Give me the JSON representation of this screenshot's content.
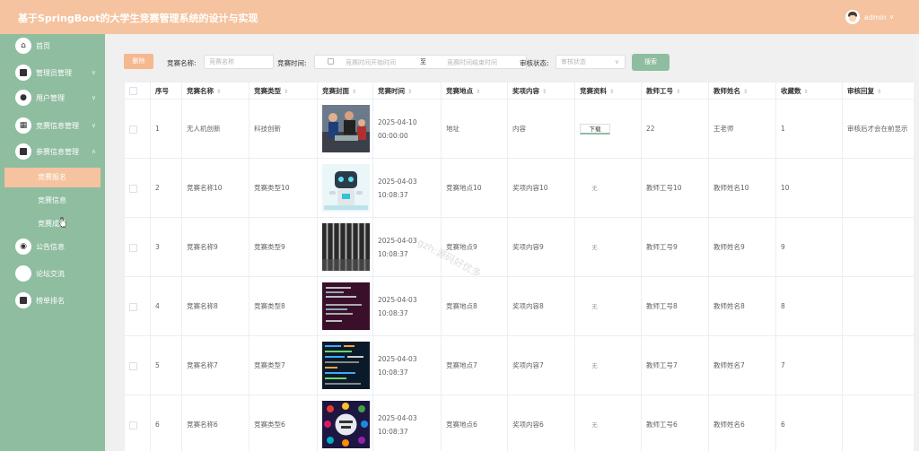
{
  "header": {
    "title": "基于SpringBoot的大学生竞赛管理系统的设计与实现",
    "username": "admin"
  },
  "sidebar": {
    "items": [
      {
        "label": "首页",
        "icon": "home-icon"
      },
      {
        "label": "管理员管理",
        "icon": "admin-icon"
      },
      {
        "label": "用户管理",
        "icon": "user-icon"
      },
      {
        "label": "竞赛信息管理",
        "icon": "grid-icon"
      },
      {
        "label": "参赛信息管理",
        "icon": "copy-icon"
      },
      {
        "label": "公告信息",
        "icon": "notice-icon"
      },
      {
        "label": "论坛交流",
        "icon": "forum-icon"
      },
      {
        "label": "榜单排名",
        "icon": "ranking-icon"
      }
    ],
    "subitems": [
      {
        "label": "竞赛报名",
        "active": true
      },
      {
        "label": "竞赛信息",
        "active": false
      },
      {
        "label": "竞赛成绩",
        "active": false
      }
    ]
  },
  "search": {
    "delete_label": "删除",
    "name_label": "竞赛名称:",
    "name_placeholder": "竞赛名称",
    "time_label": "竞赛时间:",
    "start_placeholder": "竞赛时间开始时间",
    "to_label": "至",
    "end_placeholder": "竞赛时间结束时间",
    "status_label": "审核状态:",
    "status_placeholder": "审核状态",
    "search_label": "搜索"
  },
  "table": {
    "columns": [
      "序号",
      "竞赛名称",
      "竞赛类型",
      "竞赛封面",
      "竞赛时间",
      "竞赛地点",
      "奖项内容",
      "竞赛资料",
      "教师工号",
      "教师姓名",
      "收藏数",
      "审核回复"
    ],
    "download_label": "下载",
    "none_label": "无",
    "rows": [
      {
        "no": "1",
        "name": "无人机创新",
        "type": "科技创新",
        "time": "2025-04-10 00:00:00",
        "place": "地址",
        "prize": "内容",
        "material": "download",
        "tno": "22",
        "tname": "王老师",
        "fav": "1",
        "reply": "审核后才会在前显示",
        "cover": "photo"
      },
      {
        "no": "2",
        "name": "竞赛名称10",
        "type": "竞赛类型10",
        "time": "2025-04-03 10:08:37",
        "place": "竞赛地点10",
        "prize": "奖项内容10",
        "material": "none",
        "tno": "教师工号10",
        "tname": "教师姓名10",
        "fav": "10",
        "reply": "",
        "cover": "robot"
      },
      {
        "no": "3",
        "name": "竞赛名称9",
        "type": "竞赛类型9",
        "time": "2025-04-03 10:08:37",
        "place": "竞赛地点9",
        "prize": "奖项内容9",
        "material": "none",
        "tno": "教师工号9",
        "tname": "教师姓名9",
        "fav": "9",
        "reply": "",
        "cover": "stripes"
      },
      {
        "no": "4",
        "name": "竞赛名称8",
        "type": "竞赛类型8",
        "time": "2025-04-03 10:08:37",
        "place": "竞赛地点8",
        "prize": "奖项内容8",
        "material": "none",
        "tno": "教师工号8",
        "tname": "教师姓名8",
        "fav": "8",
        "reply": "",
        "cover": "code"
      },
      {
        "no": "5",
        "name": "竞赛名称7",
        "type": "竞赛类型7",
        "time": "2025-04-03 10:08:37",
        "place": "竞赛地点7",
        "prize": "奖项内容7",
        "material": "none",
        "tno": "教师工号7",
        "tname": "教师姓名7",
        "fav": "7",
        "reply": "",
        "cover": "screen"
      },
      {
        "no": "6",
        "name": "竞赛名称6",
        "type": "竞赛类型6",
        "time": "2025-04-03 10:08:37",
        "place": "竞赛地点6",
        "prize": "奖项内容6",
        "material": "none",
        "tno": "教师工号6",
        "tname": "教师姓名6",
        "fav": "6",
        "reply": "",
        "cover": "circle"
      }
    ]
  },
  "watermark": "gzh:源码好优多",
  "colors": {
    "header": "#f5c39f",
    "sidebar": "#8fbda0",
    "active": "#f5c39f",
    "accent": "#8fbda0"
  }
}
